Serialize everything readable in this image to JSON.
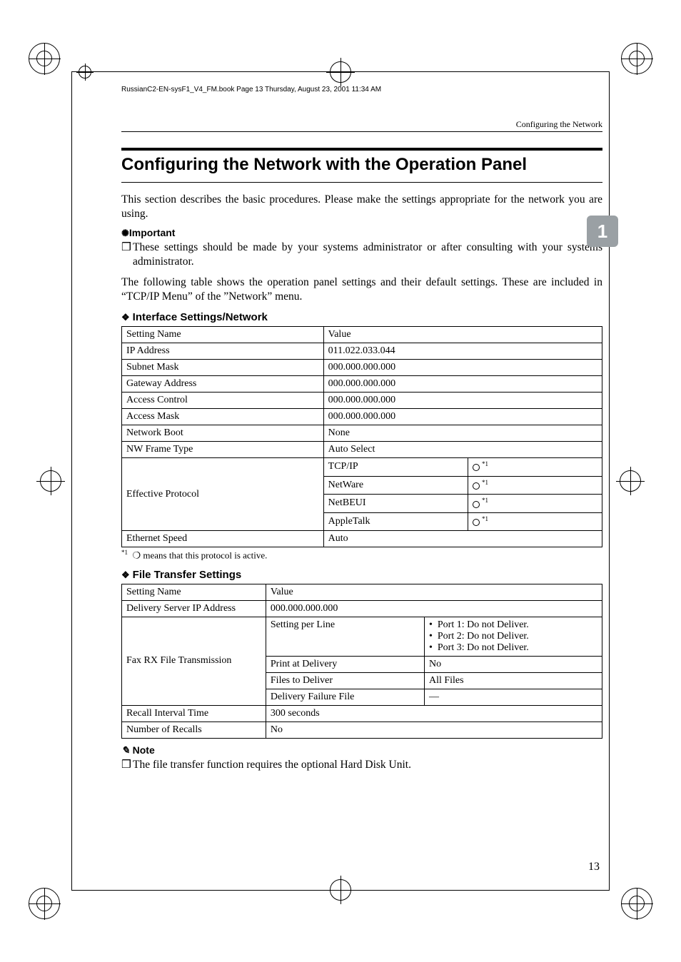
{
  "print_marks": {},
  "book_header": "RussianC2-EN-sysF1_V4_FM.book  Page 13  Thursday, August 23, 2001  11:34 AM",
  "running_head": "Configuring the Network",
  "side_tab": "1",
  "section_title": "Configuring the Network with the Operation Panel",
  "intro": "This section describes the basic procedures. Please make the settings appropriate for the network you are using.",
  "important_label": "Important",
  "important_bullet": "These settings should be made by your systems administrator or after consulting with your systems administrator.",
  "para2": "The following table shows the operation panel settings and their default settings. These are included in “TCP/IP Menu” of the ”Network” menu.",
  "table1_title": "Interface Settings/Network",
  "table1": {
    "header": {
      "c1": "Setting Name",
      "c2": "Value"
    },
    "rows": {
      "ip": {
        "name": "IP Address",
        "value": "011.022.033.044"
      },
      "subnet": {
        "name": "Subnet Mask",
        "value": "000.000.000.000"
      },
      "gateway": {
        "name": "Gateway Address",
        "value": "000.000.000.000"
      },
      "accctl": {
        "name": "Access Control",
        "value": "000.000.000.000"
      },
      "accmask": {
        "name": "Access Mask",
        "value": "000.000.000.000"
      },
      "netboot": {
        "name": "Network Boot",
        "value": "None"
      },
      "nwframe": {
        "name": "NW Frame Type",
        "value": "Auto Select"
      },
      "eff": {
        "name": "Effective Protocol",
        "p1": "TCP/IP",
        "s1": "*1",
        "p2": "NetWare",
        "s2": "*1",
        "p3": "NetBEUI",
        "s3": "*1",
        "p4": "AppleTalk",
        "s4": "*1"
      },
      "espeed": {
        "name": "Ethernet Speed",
        "value": "Auto"
      }
    }
  },
  "footnote_marker": "*1",
  "footnote_text": "❍ means that this protocol is active.",
  "table2_title": "File Transfer Settings",
  "table2": {
    "header": {
      "c1": "Setting Name",
      "c2": "Value"
    },
    "rows": {
      "delivery": {
        "name": "Delivery Server IP Address",
        "value": "000.000.000.000"
      },
      "fax": {
        "name": "Fax RX File Transmission",
        "r1c1": "Setting per Line",
        "r1b1": "Port 1:  Do not Deliver.",
        "r1b2": "Port 2:  Do not Deliver.",
        "r1b3": "Port 3:  Do not Deliver.",
        "r2c1": "Print at Delivery",
        "r2c2": "No",
        "r3c1": "Files to Deliver",
        "r3c2": "All Files",
        "r4c1": "Delivery Failure File",
        "r4c2": "—"
      },
      "recall": {
        "name": "Recall Interval Time",
        "value": "300 seconds"
      },
      "numrec": {
        "name": "Number of Recalls",
        "value": "No"
      }
    }
  },
  "note_label": "Note",
  "note_bullet": "The file transfer function requires the optional Hard Disk Unit.",
  "page_number": "13"
}
